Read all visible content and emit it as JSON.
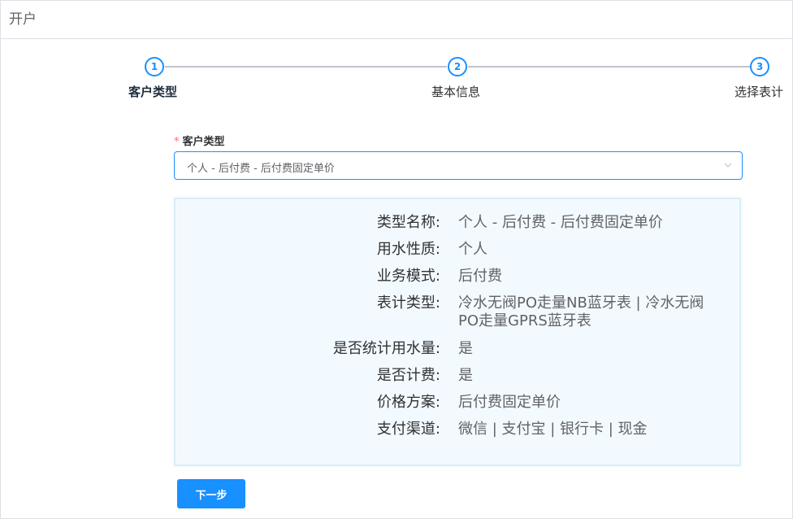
{
  "page": {
    "title": "开户"
  },
  "steps": [
    {
      "number": "1",
      "label": "客户类型"
    },
    {
      "number": "2",
      "label": "基本信息"
    },
    {
      "number": "3",
      "label": "选择表计"
    }
  ],
  "form": {
    "required_mark": "*",
    "customer_type_label": "客户类型",
    "customer_type_value": "个人 - 后付费 - 后付费固定单价"
  },
  "info": [
    {
      "key": "类型名称:",
      "value": "个人 - 后付费 - 后付费固定单价"
    },
    {
      "key": "用水性质:",
      "value": "个人"
    },
    {
      "key": "业务模式:",
      "value": "后付费"
    },
    {
      "key": "表计类型:",
      "value": "冷水无阀PO走量NB蓝牙表 | 冷水无阀PO走量GPRS蓝牙表"
    },
    {
      "key": "是否统计用水量:",
      "value": "是"
    },
    {
      "key": "是否计费:",
      "value": "是"
    },
    {
      "key": "价格方案:",
      "value": "后付费固定单价"
    },
    {
      "key": "支付渠道:",
      "value": "微信 | 支付宝 | 银行卡 | 现金"
    }
  ],
  "actions": {
    "next_label": "下一步"
  },
  "colors": {
    "primary": "#1890ff",
    "panel_bg": "#f3faff",
    "required": "#f56c6c"
  }
}
